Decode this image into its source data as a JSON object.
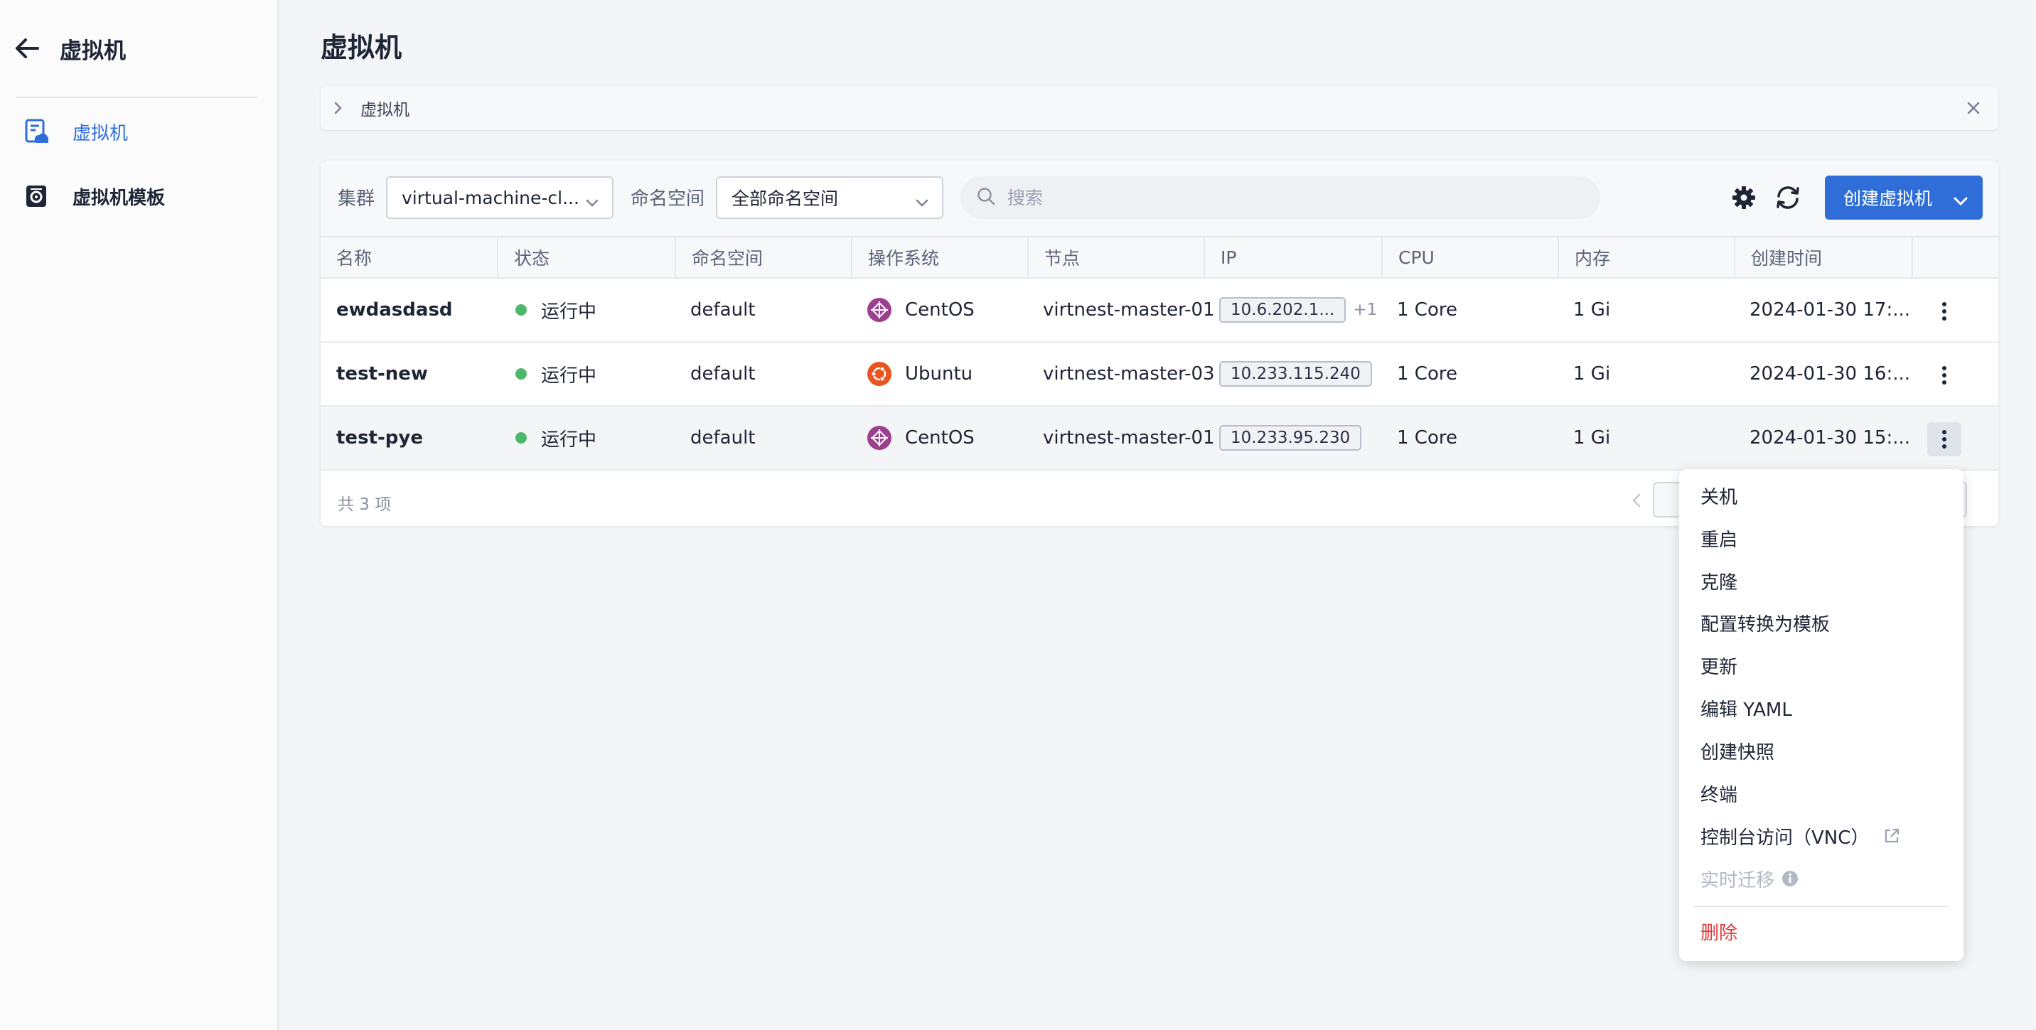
{
  "sidebar": {
    "title": "虚拟机",
    "items": [
      {
        "label": "虚拟机",
        "active": true
      },
      {
        "label": "虚拟机模板",
        "active": false
      }
    ]
  },
  "page": {
    "title": "虚拟机",
    "breadcrumb": "虚拟机"
  },
  "toolbar": {
    "cluster_label": "集群",
    "cluster_value": "virtual-machine-cl...",
    "namespace_label": "命名空间",
    "namespace_value": "全部命名空间",
    "search_placeholder": "搜索",
    "create_label": "创建虚拟机"
  },
  "table": {
    "headers": [
      "名称",
      "状态",
      "命名空间",
      "操作系统",
      "节点",
      "IP",
      "CPU",
      "内存",
      "创建时间"
    ],
    "rows": [
      {
        "name": "ewdasdasd",
        "status": "运行中",
        "namespace": "default",
        "os": "CentOS",
        "os_icon": "centos-icon",
        "node": "virtnest-master-01",
        "ip": "10.6.202.1...",
        "ip_more": "+1",
        "cpu": "1 Core",
        "memory": "1 Gi",
        "created": "2024-01-30 17:..."
      },
      {
        "name": "test-new",
        "status": "运行中",
        "namespace": "default",
        "os": "Ubuntu",
        "os_icon": "ubuntu-icon",
        "node": "virtnest-master-03",
        "ip": "10.233.115.240",
        "ip_more": "",
        "cpu": "1 Core",
        "memory": "1 Gi",
        "created": "2024-01-30 16:..."
      },
      {
        "name": "test-pye",
        "status": "运行中",
        "namespace": "default",
        "os": "CentOS",
        "os_icon": "centos-icon",
        "node": "virtnest-master-01",
        "ip": "10.233.95.230",
        "ip_more": "",
        "cpu": "1 Core",
        "memory": "1 Gi",
        "created": "2024-01-30 15:..."
      }
    ],
    "total": "共 3 项"
  },
  "menu": {
    "items": [
      "关机",
      "重启",
      "克隆",
      "配置转换为模板",
      "更新",
      "编辑 YAML",
      "创建快照",
      "终端",
      "控制台访问（VNC）",
      "实时迁移"
    ],
    "delete_label": "删除"
  },
  "colors": {
    "accent": "#2f6ed8",
    "running": "#4cb96a",
    "danger": "#e03b3b",
    "centos": "#9b3f8f",
    "ubuntu": "#e95420"
  }
}
